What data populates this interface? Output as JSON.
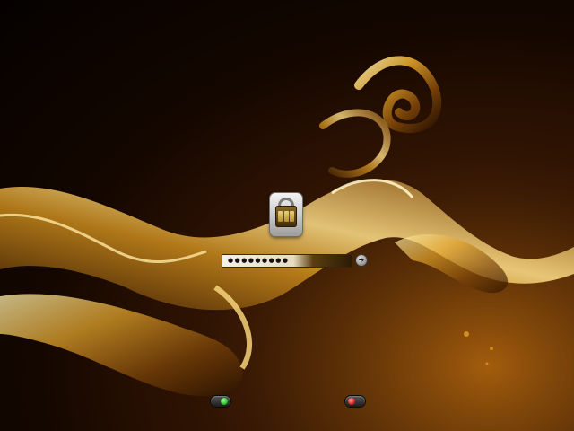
{
  "login": {
    "password_mask": "●●●●●●●●●",
    "submit_icon": "arrow-right-icon"
  },
  "user_tile": {
    "icon": "combination-lock-icon"
  },
  "bottom_controls": {
    "left_toggle": {
      "icon": "toggle-switch-icon",
      "state": "on",
      "color": "#2fcc2f"
    },
    "right_toggle": {
      "icon": "toggle-switch-icon",
      "state": "off",
      "color": "#e02a2a"
    }
  },
  "theme": {
    "background": "#050100",
    "accent": "#d9a12a"
  }
}
